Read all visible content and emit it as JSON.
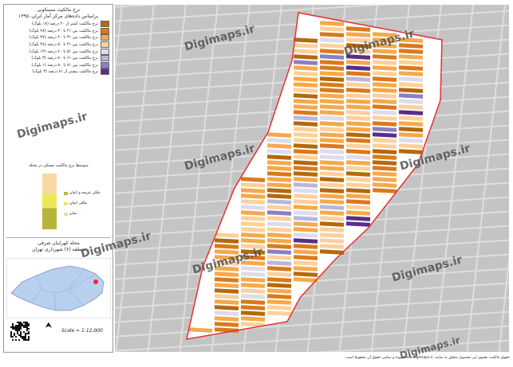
{
  "title": {
    "line1": "نرخ مالکیت مستکونی",
    "line2": "براساس داده‌های مرکز آمار ایران، ۱۳۹۵"
  },
  "legend": [
    {
      "label": "نرخ مالکیت کمتر از ۲۰ درصد (۱۸ بلوک)",
      "color": "#b4690a"
    },
    {
      "label": "نرخ مالکیت بین ۲۱ تا ۳۰ درصد (۲۸ بلوک)",
      "color": "#d97a1c"
    },
    {
      "label": "نرخ مالکیت بین ۳۱ تا ۴۰ درصد (۴۷ بلوک)",
      "color": "#f5a94b"
    },
    {
      "label": "نرخ مالکیت بین ۴۱ تا ۵۰ درصد (۴۸ بلوک)",
      "color": "#fdd09b"
    },
    {
      "label": "نرخ مالکیت بین ۵۱ تا ۶۰ درصد (۱۳ بلوک)",
      "color": "#dcdced"
    },
    {
      "label": "نرخ مالکیت بین ۶۱ تا ۷۰ درصد (۳ بلوک)",
      "color": "#b9b6da"
    },
    {
      "label": "نرخ مالکیت بین ۷۱ تا ۸۰ درصد (۱ بلوک)",
      "color": "#8c7fbf"
    },
    {
      "label": "نرخ مالکیت بیشتر از ۸۱ درصد (۳ بلوک)",
      "color": "#5a2e86"
    }
  ],
  "chart_data": {
    "type": "bar",
    "title": "متوسط نرخ مالکیت مسکن در محله",
    "series": [
      {
        "name": "ملکی عرصه و اعیان",
        "value": 38,
        "color": "#b5b53a"
      },
      {
        "name": "ملکی اعیان",
        "value": 26,
        "color": "#ede855"
      },
      {
        "name": "سایر",
        "value": 36,
        "color": "#f7d9a3"
      }
    ]
  },
  "area": {
    "line1": "محله کهرابیان شرقی",
    "line2": "منطقه (۶) شهرداری تهران"
  },
  "scale": "Scale = 1:12,000",
  "credit": "حقوق مالکیت معنوی این محصول متعلق به سایت www.digimaps.ir بوده و تمامی حقوق آن محفوظ است.",
  "watermark": "Digimaps.ir",
  "colors": {
    "boundary": "#e5312f",
    "road": "#d6d6d6",
    "bg": "#c7c7c7"
  }
}
